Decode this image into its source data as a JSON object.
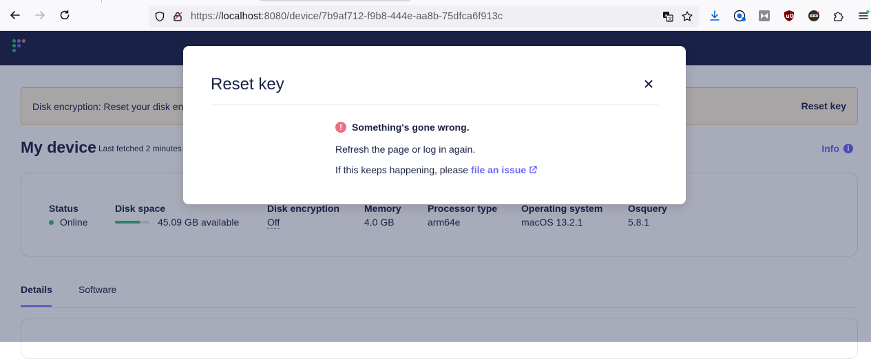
{
  "browser": {
    "url_prefix": "https://",
    "url_host": "localhost",
    "url_rest": ":8080/device/7b9af712-f9b8-444e-aa8b-75dfca6f913c"
  },
  "banner": {
    "text": "Disk encryption: Reset your disk en",
    "button_label": "Reset key"
  },
  "page": {
    "title": "My device",
    "fetched": "Last fetched 2 minutes",
    "info_label": "Info"
  },
  "stats": [
    {
      "label": "Status",
      "value": "Online"
    },
    {
      "label": "Disk space",
      "value": "45.09 GB available",
      "used_fraction": 0.72
    },
    {
      "label": "Disk encryption",
      "value": "Off"
    },
    {
      "label": "Memory",
      "value": "4.0 GB"
    },
    {
      "label": "Processor type",
      "value": "arm64e"
    },
    {
      "label": "Operating system",
      "value": "macOS 13.2.1"
    },
    {
      "label": "Osquery",
      "value": "5.8.1"
    }
  ],
  "tabs": [
    {
      "label": "Details"
    },
    {
      "label": "Software"
    }
  ],
  "modal": {
    "title": "Reset key",
    "error_title": "Something's gone wrong.",
    "body_line1": "Refresh the page or log in again.",
    "body_line2_prefix": "If this keeps happening, please",
    "link_label": "file an issue"
  },
  "colors": {
    "navy": "#192147",
    "accent": "#6a67fe",
    "online": "#3db67b",
    "error": "#ed6e85"
  }
}
